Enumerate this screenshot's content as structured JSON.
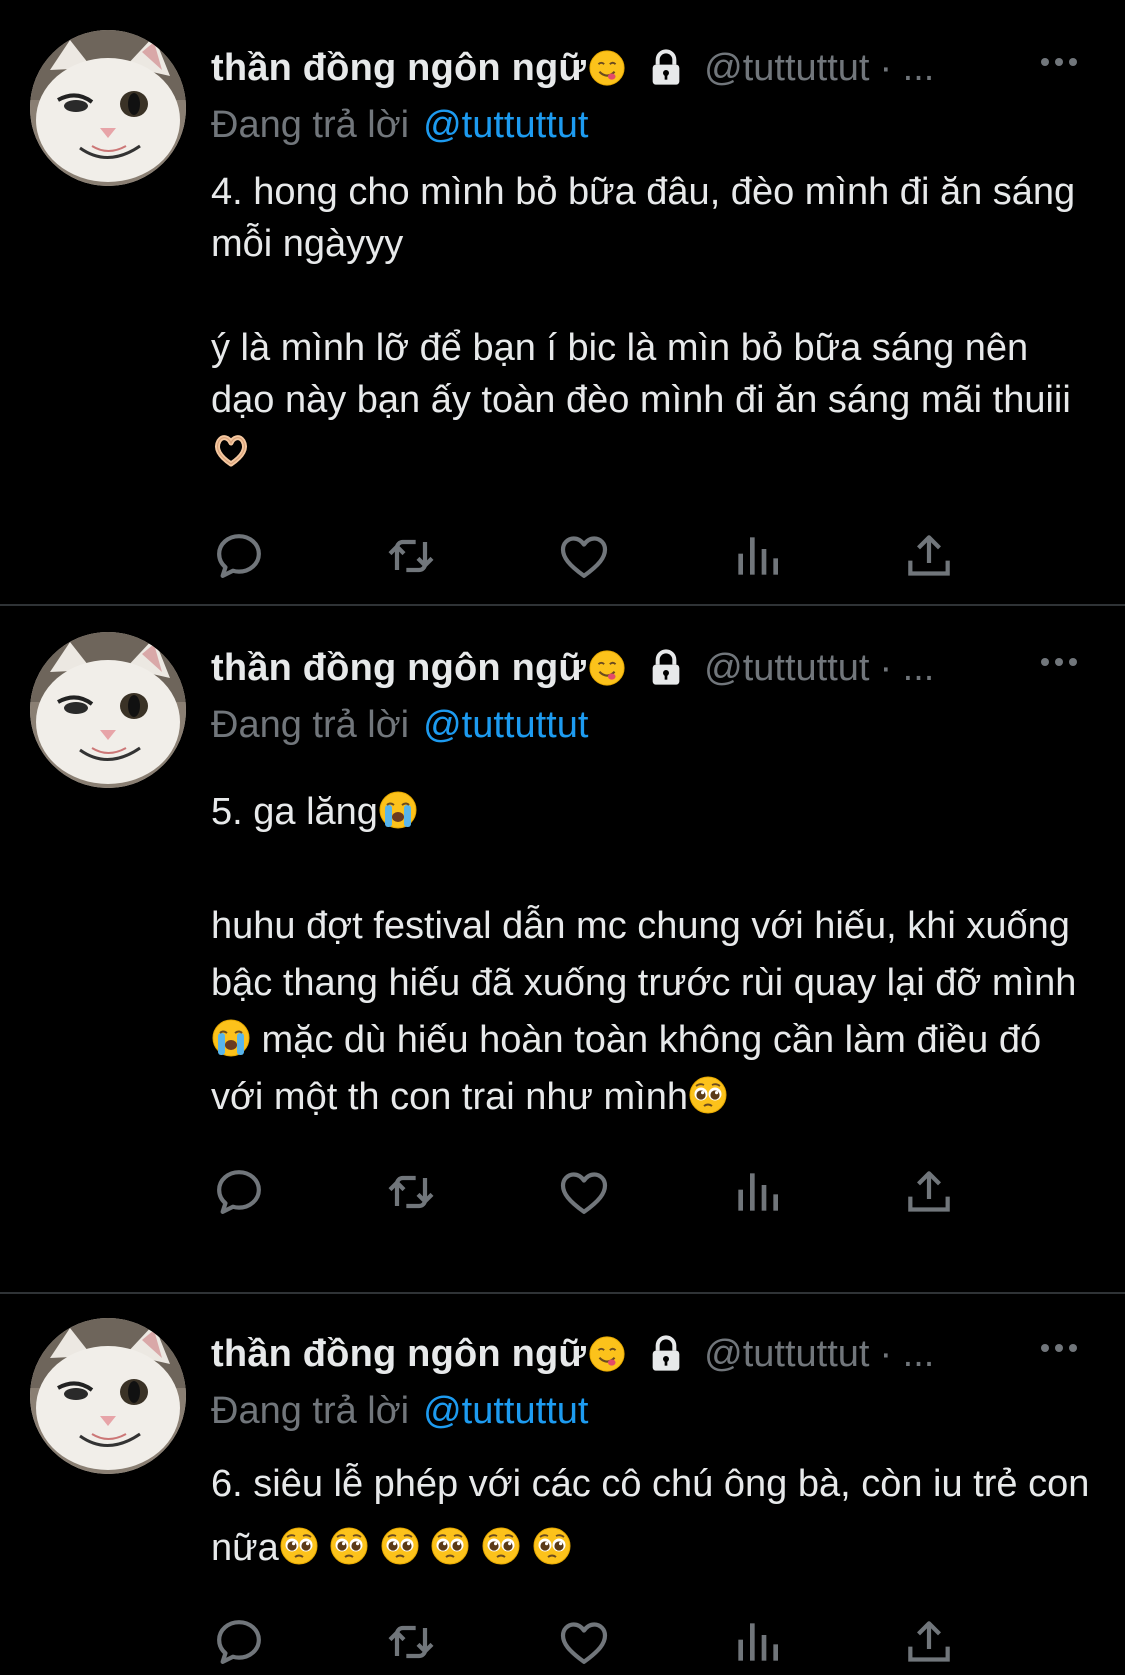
{
  "tweets": [
    {
      "display_name": "thần đồng ngôn ngữ",
      "name_emoji": "face-savoring-food-emoji",
      "lock_icon": "lock-icon",
      "handle": "@tuttuttut",
      "dots": "· ...",
      "reply_prefix": "Đang trả lời",
      "reply_to": "@tuttuttut",
      "paragraphs": [
        [
          "4. hong cho mình bỏ bữa đâu, đèo mình đi ăn sáng mỗi ngàyyy"
        ],
        [
          "ý là mình lỡ để bạn í bic là mìn bỏ bữa sáng nên dạo này bạn ấy toàn đèo mình đi ăn sáng mãi thuiii",
          "heart-hands-emoji"
        ]
      ]
    },
    {
      "display_name": "thần đồng ngôn ngữ",
      "name_emoji": "face-savoring-food-emoji",
      "lock_icon": "lock-icon",
      "handle": "@tuttuttut",
      "dots": "· ...",
      "reply_prefix": "Đang trả lời",
      "reply_to": "@tuttuttut",
      "paragraphs": [
        [
          "5. ga lăng",
          "crying-face-emoji"
        ],
        [
          "huhu đợt festival dẫn mc chung với hiếu, khi xuống bậc thang hiếu đã xuống trước rùi quay lại đỡ mình",
          "crying-face-emoji",
          " mặc dù hiếu hoàn toàn không cần làm điều đó với một th con trai như mình",
          "pleading-face-emoji"
        ]
      ]
    },
    {
      "display_name": "thần đồng ngôn ngữ",
      "name_emoji": "face-savoring-food-emoji",
      "lock_icon": "lock-icon",
      "handle": "@tuttuttut",
      "dots": "· ...",
      "reply_prefix": "Đang trả lời",
      "reply_to": "@tuttuttut",
      "paragraphs": [
        [
          "6. siêu lễ phép với các cô chú ông bà, còn iu trẻ con nữa",
          "pleading-face-emoji",
          " ",
          "pleading-face-emoji",
          " ",
          "pleading-face-emoji",
          " ",
          "pleading-face-emoji",
          " ",
          "pleading-face-emoji",
          " ",
          "pleading-face-emoji"
        ]
      ]
    }
  ],
  "action_icons": [
    "reply-icon",
    "retweet-icon",
    "like-icon",
    "views-icon",
    "share-icon"
  ],
  "colors": {
    "background": "#000000",
    "divider": "#2f3336",
    "primary_text": "#e7e9ea",
    "secondary_text": "#71767b",
    "link": "#1d9bf0"
  }
}
